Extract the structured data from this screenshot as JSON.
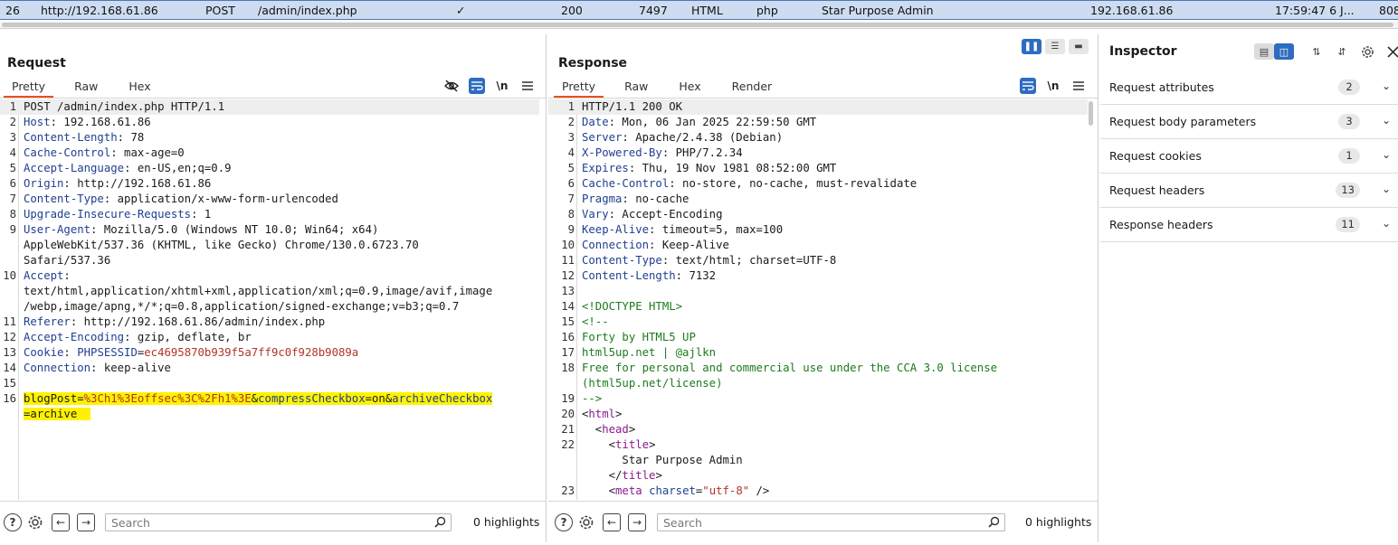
{
  "history_row": {
    "num": "26",
    "host": "http://192.168.61.86",
    "method": "POST",
    "url": "/admin/index.php",
    "edited": "✓",
    "status": "200",
    "length": "7497",
    "mime": "HTML",
    "ext": "php",
    "title": "Star Purpose Admin",
    "ip": "192.168.61.86",
    "time": "17:59:47 6 J...",
    "port": "808"
  },
  "request": {
    "title": "Request",
    "tabs": [
      "Pretty",
      "Raw",
      "Hex"
    ],
    "lines": [
      {
        "n": "1",
        "parts": [
          {
            "t": "POST /admin/index.php HTTP/1.1",
            "c": "val"
          }
        ]
      },
      {
        "n": "2",
        "parts": [
          {
            "t": "Host",
            "c": "hname"
          },
          {
            "t": ": 192.168.61.86",
            "c": "val"
          }
        ]
      },
      {
        "n": "3",
        "parts": [
          {
            "t": "Content-Length",
            "c": "hname"
          },
          {
            "t": ": 78",
            "c": "val"
          }
        ]
      },
      {
        "n": "4",
        "parts": [
          {
            "t": "Cache-Control",
            "c": "hname"
          },
          {
            "t": ": max-age=0",
            "c": "val"
          }
        ]
      },
      {
        "n": "5",
        "parts": [
          {
            "t": "Accept-Language",
            "c": "hname"
          },
          {
            "t": ": en-US,en;q=0.9",
            "c": "val"
          }
        ]
      },
      {
        "n": "6",
        "parts": [
          {
            "t": "Origin",
            "c": "hname"
          },
          {
            "t": ": http://192.168.61.86",
            "c": "val"
          }
        ]
      },
      {
        "n": "7",
        "parts": [
          {
            "t": "Content-Type",
            "c": "hname"
          },
          {
            "t": ": application/x-www-form-urlencoded",
            "c": "val"
          }
        ]
      },
      {
        "n": "8",
        "parts": [
          {
            "t": "Upgrade-Insecure-Requests",
            "c": "hname"
          },
          {
            "t": ": 1",
            "c": "val"
          }
        ]
      },
      {
        "n": "9",
        "parts": [
          {
            "t": "User-Agent",
            "c": "hname"
          },
          {
            "t": ": Mozilla/5.0 (Windows NT 10.0; Win64; x64)",
            "c": "val"
          }
        ]
      },
      {
        "n": "",
        "parts": [
          {
            "t": "AppleWebKit/537.36 (KHTML, like Gecko) Chrome/130.0.6723.70",
            "c": "val"
          }
        ]
      },
      {
        "n": "",
        "parts": [
          {
            "t": "Safari/537.36",
            "c": "val"
          }
        ]
      },
      {
        "n": "10",
        "parts": [
          {
            "t": "Accept",
            "c": "hname"
          },
          {
            "t": ":",
            "c": "val"
          }
        ]
      },
      {
        "n": "",
        "parts": [
          {
            "t": "text/html,application/xhtml+xml,application/xml;q=0.9,image/avif,image",
            "c": "val"
          }
        ]
      },
      {
        "n": "",
        "parts": [
          {
            "t": "/webp,image/apng,*/*;q=0.8,application/signed-exchange;v=b3;q=0.7",
            "c": "val"
          }
        ]
      },
      {
        "n": "11",
        "parts": [
          {
            "t": "Referer",
            "c": "hname"
          },
          {
            "t": ": http://192.168.61.86/admin/index.php",
            "c": "val"
          }
        ]
      },
      {
        "n": "12",
        "parts": [
          {
            "t": "Accept-Encoding",
            "c": "hname"
          },
          {
            "t": ": gzip, deflate, br",
            "c": "val"
          }
        ]
      },
      {
        "n": "13",
        "parts": [
          {
            "t": "Cookie",
            "c": "hname"
          },
          {
            "t": ": ",
            "c": "val"
          },
          {
            "t": "PHPSESSID",
            "c": "hname"
          },
          {
            "t": "=",
            "c": "val"
          },
          {
            "t": "ec4695870b939f5a7ff9c0f928b9089a",
            "c": "cookieval"
          }
        ]
      },
      {
        "n": "14",
        "parts": [
          {
            "t": "Connection",
            "c": "hname"
          },
          {
            "t": ": keep-alive",
            "c": "val"
          }
        ]
      },
      {
        "n": "15",
        "parts": []
      },
      {
        "n": "16",
        "hl": true,
        "parts": [
          {
            "t": "blogPost",
            "c": "val"
          },
          {
            "t": "=",
            "c": "val"
          },
          {
            "t": "%3Ch1%3Eoffsec%3C%2Fh1%3E",
            "c": "str"
          },
          {
            "t": "&",
            "c": "val"
          },
          {
            "t": "compressCheckbox",
            "c": "hname"
          },
          {
            "t": "=on&",
            "c": "val"
          },
          {
            "t": "archiveCheckbox",
            "c": "hname"
          }
        ]
      },
      {
        "n": "",
        "hl": true,
        "parts": [
          {
            "t": "=archive  ",
            "c": "val"
          }
        ]
      }
    ],
    "search_placeholder": "Search",
    "highlights": "0 highlights"
  },
  "response": {
    "title": "Response",
    "tabs": [
      "Pretty",
      "Raw",
      "Hex",
      "Render"
    ],
    "lines": [
      {
        "n": "1",
        "parts": [
          {
            "t": "HTTP/1.1 200 OK",
            "c": "val"
          }
        ]
      },
      {
        "n": "2",
        "parts": [
          {
            "t": "Date",
            "c": "hname"
          },
          {
            "t": ": Mon, 06 Jan 2025 22:59:50 GMT",
            "c": "val"
          }
        ]
      },
      {
        "n": "3",
        "parts": [
          {
            "t": "Server",
            "c": "hname"
          },
          {
            "t": ": Apache/2.4.38 (Debian)",
            "c": "val"
          }
        ]
      },
      {
        "n": "4",
        "parts": [
          {
            "t": "X-Powered-By",
            "c": "hname"
          },
          {
            "t": ": PHP/7.2.34",
            "c": "val"
          }
        ]
      },
      {
        "n": "5",
        "parts": [
          {
            "t": "Expires",
            "c": "hname"
          },
          {
            "t": ": Thu, 19 Nov 1981 08:52:00 GMT",
            "c": "val"
          }
        ]
      },
      {
        "n": "6",
        "parts": [
          {
            "t": "Cache-Control",
            "c": "hname"
          },
          {
            "t": ": no-store, no-cache, must-revalidate",
            "c": "val"
          }
        ]
      },
      {
        "n": "7",
        "parts": [
          {
            "t": "Pragma",
            "c": "hname"
          },
          {
            "t": ": no-cache",
            "c": "val"
          }
        ]
      },
      {
        "n": "8",
        "parts": [
          {
            "t": "Vary",
            "c": "hname"
          },
          {
            "t": ": Accept-Encoding",
            "c": "val"
          }
        ]
      },
      {
        "n": "9",
        "parts": [
          {
            "t": "Keep-Alive",
            "c": "hname"
          },
          {
            "t": ": timeout=5, max=100",
            "c": "val"
          }
        ]
      },
      {
        "n": "10",
        "parts": [
          {
            "t": "Connection",
            "c": "hname"
          },
          {
            "t": ": Keep-Alive",
            "c": "val"
          }
        ]
      },
      {
        "n": "11",
        "parts": [
          {
            "t": "Content-Type",
            "c": "hname"
          },
          {
            "t": ": text/html; charset=UTF-8",
            "c": "val"
          }
        ]
      },
      {
        "n": "12",
        "parts": [
          {
            "t": "Content-Length",
            "c": "hname"
          },
          {
            "t": ": 7132",
            "c": "val"
          }
        ]
      },
      {
        "n": "13",
        "parts": []
      },
      {
        "n": "14",
        "parts": [
          {
            "t": "<!DOCTYPE HTML>",
            "c": "cmt"
          }
        ]
      },
      {
        "n": "15",
        "parts": [
          {
            "t": "<!--",
            "c": "cmt"
          }
        ]
      },
      {
        "n": "16",
        "parts": [
          {
            "t": "Forty by HTML5 UP",
            "c": "cmt"
          }
        ]
      },
      {
        "n": "17",
        "parts": [
          {
            "t": "html5up.net | @ajlkn",
            "c": "cmt"
          }
        ]
      },
      {
        "n": "18",
        "parts": [
          {
            "t": "Free for personal and commercial use under the CCA 3.0 license",
            "c": "cmt"
          }
        ]
      },
      {
        "n": "",
        "parts": [
          {
            "t": "(html5up.net/license)",
            "c": "cmt"
          }
        ]
      },
      {
        "n": "19",
        "parts": [
          {
            "t": "-->",
            "c": "cmt"
          }
        ]
      },
      {
        "n": "20",
        "parts": [
          {
            "t": "<",
            "c": "val"
          },
          {
            "t": "html",
            "c": "tag"
          },
          {
            "t": ">",
            "c": "val"
          }
        ]
      },
      {
        "n": "21",
        "parts": [
          {
            "t": "  <",
            "c": "val"
          },
          {
            "t": "head",
            "c": "tag"
          },
          {
            "t": ">",
            "c": "val"
          }
        ]
      },
      {
        "n": "22",
        "parts": [
          {
            "t": "    <",
            "c": "val"
          },
          {
            "t": "title",
            "c": "tag"
          },
          {
            "t": ">",
            "c": "val"
          }
        ]
      },
      {
        "n": "",
        "parts": [
          {
            "t": "      Star Purpose Admin",
            "c": "val"
          }
        ]
      },
      {
        "n": "",
        "parts": [
          {
            "t": "    </",
            "c": "val"
          },
          {
            "t": "title",
            "c": "tag"
          },
          {
            "t": ">",
            "c": "val"
          }
        ]
      },
      {
        "n": "23",
        "parts": [
          {
            "t": "    <",
            "c": "val"
          },
          {
            "t": "meta",
            "c": "tag"
          },
          {
            "t": " ",
            "c": "val"
          },
          {
            "t": "charset",
            "c": "attr"
          },
          {
            "t": "=",
            "c": "val"
          },
          {
            "t": "\"utf-8\"",
            "c": "str"
          },
          {
            "t": " />",
            "c": "val"
          }
        ]
      }
    ],
    "search_placeholder": "Search",
    "highlights": "0 highlights"
  },
  "inspector": {
    "title": "Inspector",
    "rows": [
      {
        "label": "Request attributes",
        "count": "2"
      },
      {
        "label": "Request body parameters",
        "count": "3"
      },
      {
        "label": "Request cookies",
        "count": "1"
      },
      {
        "label": "Request headers",
        "count": "13"
      },
      {
        "label": "Response headers",
        "count": "11"
      }
    ]
  },
  "icons": {
    "eye_slash": "eye-slash-icon",
    "wrap": "wrap-icon",
    "newline": "\\n",
    "menu": "menu-icon",
    "help": "?",
    "settings": "gear-icon",
    "back": "arrow-left-icon",
    "forward": "arrow-right-icon",
    "search": "search-icon"
  },
  "colors": {
    "accent": "#2d6cc0",
    "tab_underline": "#e8501e",
    "highlight": "#fff200",
    "selected_row": "#cddcf0"
  }
}
